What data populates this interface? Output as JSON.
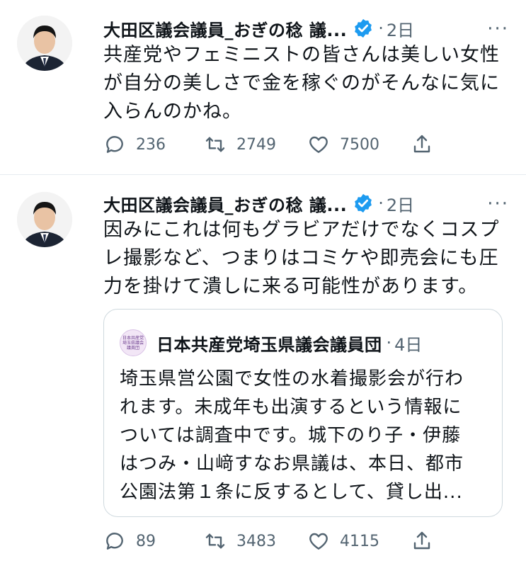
{
  "tweets": [
    {
      "author": "大田区議会議員_おぎの稔 議...",
      "time": "2日",
      "more": "···",
      "lines": [
        "共産党やフェミニストの皆さんは美しい女性",
        "が自分の美しさで金を稼ぐのがそんなに気に",
        "入らんのかね。"
      ],
      "reply_count": "236",
      "retweet_count": "2749",
      "like_count": "7500"
    },
    {
      "author": "大田区議会議員_おぎの稔 議...",
      "time": "2日",
      "more": "···",
      "lines": [
        "因みにこれは何もグラビアだけでなくコスプ",
        "レ撮影など、つまりはコミケや即売会にも圧",
        "力を掛けて潰しに来る可能性があります。"
      ],
      "quote": {
        "avatar_lines": [
          "日本共産党",
          "埼玉県議会",
          "議員団"
        ],
        "author": "日本共産党埼玉県議会議員団",
        "time": "4日",
        "lines": [
          "埼玉県営公園で女性の水着撮影会が行わ",
          "れます。未成年も出演するという情報に",
          "ついては調査中です。城下のり子・伊藤",
          "はつみ・山﨑すなお県議は、本日、都市",
          "公園法第１条に反するとして、貸し出..."
        ]
      },
      "reply_count": "89",
      "retweet_count": "3483",
      "like_count": "4115"
    }
  ],
  "colors": {
    "verified": "#1d9bf0",
    "muted": "#536471",
    "text": "#0f1419"
  },
  "icons": [
    "verified-badge-icon",
    "reply-icon",
    "retweet-icon",
    "like-icon",
    "share-icon",
    "more-icon"
  ]
}
